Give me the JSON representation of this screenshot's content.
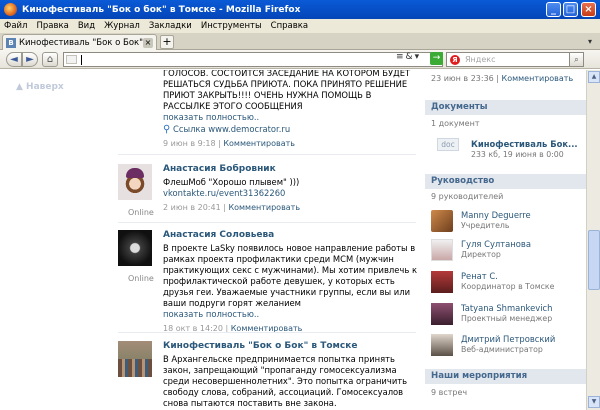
{
  "window": {
    "title": "Кинофестиваль \"Бок о бок\" в Томске - Mozilla Firefox",
    "min": "_",
    "max": "□",
    "close": "×"
  },
  "menu": [
    "Файл",
    "Правка",
    "Вид",
    "Журнал",
    "Закладки",
    "Инструменты",
    "Справка"
  ],
  "tab": {
    "favicon": "В",
    "label": "Кинофестиваль \"Бок о Бок\" в Томске",
    "close": "×",
    "new": "+",
    "list": "▾"
  },
  "nav": {
    "back": "◄",
    "forward": "►",
    "home": "⌂",
    "url": "",
    "url_icons": [
      "≡",
      "&",
      "▾"
    ],
    "go": "→",
    "search_placeholder": "Яндекс",
    "search_engine": "Я",
    "search_btn": "⌕"
  },
  "left": {
    "up_label": "▲ Наверх"
  },
  "wall": {
    "posts": [
      {
        "text": "ГОЛОСОВ. СОСТОИТСЯ ЗАСЕДАНИЕ НА КОТОРОМ БУДЕТ РЕШАТЬСЯ СУДЬБА ПРИЮТА. ПОКА ПРИНЯТО РЕШЕНИЕ ПРИЮТ ЗАКРЫТЬ!!!! ОЧЕНЬ НУЖНА ПОМОЩЬ В РАССЫЛКЕ ЭТОГО СООБЩЕНИЯ",
        "more": "показать полностью..",
        "link": "Ссылка www.democrator.ru",
        "date": "9 июн в 9:18",
        "comment": "Комментировать"
      },
      {
        "author": "Анастасия Бобровник",
        "text": "ФлешМоб \"Хорошо плывем\" )))",
        "text_link": "vkontakte.ru/event31362260",
        "date": "2 июн в 20:41",
        "comment": "Комментировать",
        "status": "Online"
      },
      {
        "author": "Анастасия Соловьева",
        "text": "В проекте LaSky появилось новое направление работы в рамках проекта профилактики среди МСМ (мужчин практикующих секс с мужчинами). Мы хотим привлечь к профилактической работе девушек, у которых есть друзья геи. Уважаемые участники группы, если вы или ваши подруги горят желанием",
        "more": "показать полностью..",
        "date": "18 окт в 14:20",
        "comment": "Комментировать",
        "status": "Online"
      },
      {
        "author": "Кинофестиваль \"Бок о Бок\" в Томске",
        "text": "В Архангельске предпринимается попытка принять закон, запрещающий \"пропаганду гомосексуализма среди несовершеннолетних\". Это попытка ограничить свободу слова, собраний, ассоциаций. Гомосексуалов снова пытаются поставить вне закона."
      }
    ]
  },
  "sidebar": {
    "date_fragment": "23 июн в 23:36",
    "comment_fragment": "Комментировать",
    "documents": {
      "title": "Документы",
      "count": "1 документ",
      "icon": "doc",
      "name": "Кинофестиваль Бок...",
      "info": "233 кб, 19 июня в 0:00"
    },
    "management": {
      "title": "Руководство",
      "count": "9 руководителей",
      "people": [
        {
          "name": "Manny Deguerre",
          "role": "Учредитель"
        },
        {
          "name": "Гуля Султанова",
          "role": "Директор"
        },
        {
          "name": "Ренат С.",
          "role": "Координатор в Томске"
        },
        {
          "name": "Tatyana Shmankevich",
          "role": "Проектный менеджер"
        },
        {
          "name": "Дмитрий Петровский",
          "role": "Веб-администратор"
        }
      ]
    },
    "events": {
      "title": "Наши мероприятия",
      "count": "9 встреч"
    }
  }
}
